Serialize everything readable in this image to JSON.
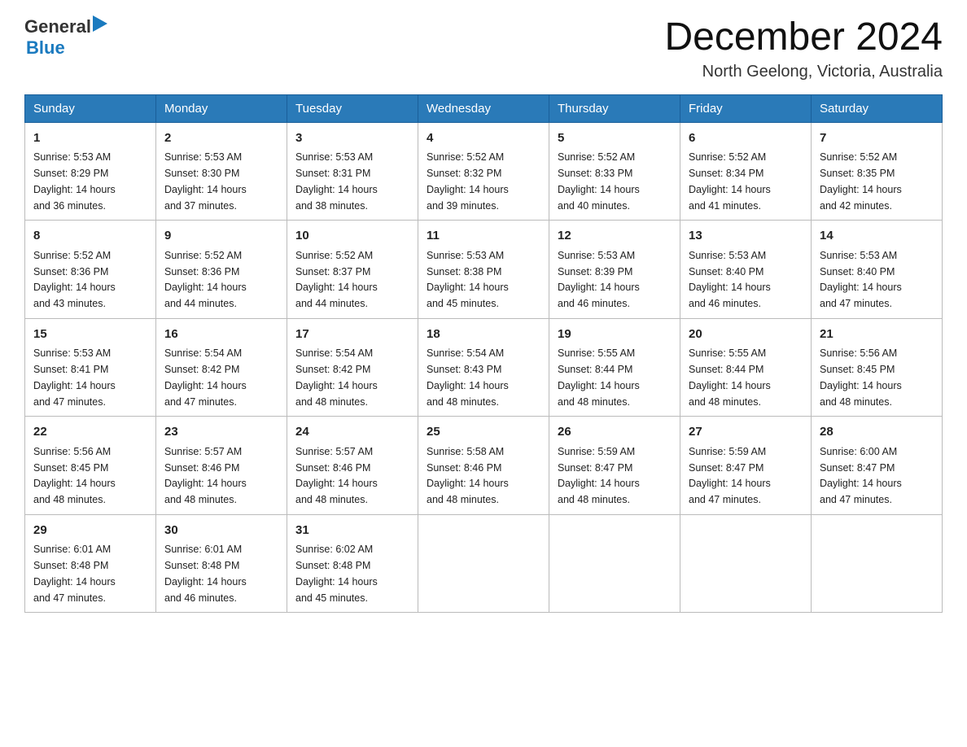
{
  "header": {
    "logo_general": "General",
    "logo_arrow": "▶",
    "logo_blue": "Blue",
    "month_title": "December 2024",
    "location": "North Geelong, Victoria, Australia"
  },
  "weekdays": [
    "Sunday",
    "Monday",
    "Tuesday",
    "Wednesday",
    "Thursday",
    "Friday",
    "Saturday"
  ],
  "weeks": [
    [
      {
        "day": "1",
        "sunrise": "5:53 AM",
        "sunset": "8:29 PM",
        "daylight": "14 hours and 36 minutes."
      },
      {
        "day": "2",
        "sunrise": "5:53 AM",
        "sunset": "8:30 PM",
        "daylight": "14 hours and 37 minutes."
      },
      {
        "day": "3",
        "sunrise": "5:53 AM",
        "sunset": "8:31 PM",
        "daylight": "14 hours and 38 minutes."
      },
      {
        "day": "4",
        "sunrise": "5:52 AM",
        "sunset": "8:32 PM",
        "daylight": "14 hours and 39 minutes."
      },
      {
        "day": "5",
        "sunrise": "5:52 AM",
        "sunset": "8:33 PM",
        "daylight": "14 hours and 40 minutes."
      },
      {
        "day": "6",
        "sunrise": "5:52 AM",
        "sunset": "8:34 PM",
        "daylight": "14 hours and 41 minutes."
      },
      {
        "day": "7",
        "sunrise": "5:52 AM",
        "sunset": "8:35 PM",
        "daylight": "14 hours and 42 minutes."
      }
    ],
    [
      {
        "day": "8",
        "sunrise": "5:52 AM",
        "sunset": "8:36 PM",
        "daylight": "14 hours and 43 minutes."
      },
      {
        "day": "9",
        "sunrise": "5:52 AM",
        "sunset": "8:36 PM",
        "daylight": "14 hours and 44 minutes."
      },
      {
        "day": "10",
        "sunrise": "5:52 AM",
        "sunset": "8:37 PM",
        "daylight": "14 hours and 44 minutes."
      },
      {
        "day": "11",
        "sunrise": "5:53 AM",
        "sunset": "8:38 PM",
        "daylight": "14 hours and 45 minutes."
      },
      {
        "day": "12",
        "sunrise": "5:53 AM",
        "sunset": "8:39 PM",
        "daylight": "14 hours and 46 minutes."
      },
      {
        "day": "13",
        "sunrise": "5:53 AM",
        "sunset": "8:40 PM",
        "daylight": "14 hours and 46 minutes."
      },
      {
        "day": "14",
        "sunrise": "5:53 AM",
        "sunset": "8:40 PM",
        "daylight": "14 hours and 47 minutes."
      }
    ],
    [
      {
        "day": "15",
        "sunrise": "5:53 AM",
        "sunset": "8:41 PM",
        "daylight": "14 hours and 47 minutes."
      },
      {
        "day": "16",
        "sunrise": "5:54 AM",
        "sunset": "8:42 PM",
        "daylight": "14 hours and 47 minutes."
      },
      {
        "day": "17",
        "sunrise": "5:54 AM",
        "sunset": "8:42 PM",
        "daylight": "14 hours and 48 minutes."
      },
      {
        "day": "18",
        "sunrise": "5:54 AM",
        "sunset": "8:43 PM",
        "daylight": "14 hours and 48 minutes."
      },
      {
        "day": "19",
        "sunrise": "5:55 AM",
        "sunset": "8:44 PM",
        "daylight": "14 hours and 48 minutes."
      },
      {
        "day": "20",
        "sunrise": "5:55 AM",
        "sunset": "8:44 PM",
        "daylight": "14 hours and 48 minutes."
      },
      {
        "day": "21",
        "sunrise": "5:56 AM",
        "sunset": "8:45 PM",
        "daylight": "14 hours and 48 minutes."
      }
    ],
    [
      {
        "day": "22",
        "sunrise": "5:56 AM",
        "sunset": "8:45 PM",
        "daylight": "14 hours and 48 minutes."
      },
      {
        "day": "23",
        "sunrise": "5:57 AM",
        "sunset": "8:46 PM",
        "daylight": "14 hours and 48 minutes."
      },
      {
        "day": "24",
        "sunrise": "5:57 AM",
        "sunset": "8:46 PM",
        "daylight": "14 hours and 48 minutes."
      },
      {
        "day": "25",
        "sunrise": "5:58 AM",
        "sunset": "8:46 PM",
        "daylight": "14 hours and 48 minutes."
      },
      {
        "day": "26",
        "sunrise": "5:59 AM",
        "sunset": "8:47 PM",
        "daylight": "14 hours and 48 minutes."
      },
      {
        "day": "27",
        "sunrise": "5:59 AM",
        "sunset": "8:47 PM",
        "daylight": "14 hours and 47 minutes."
      },
      {
        "day": "28",
        "sunrise": "6:00 AM",
        "sunset": "8:47 PM",
        "daylight": "14 hours and 47 minutes."
      }
    ],
    [
      {
        "day": "29",
        "sunrise": "6:01 AM",
        "sunset": "8:48 PM",
        "daylight": "14 hours and 47 minutes."
      },
      {
        "day": "30",
        "sunrise": "6:01 AM",
        "sunset": "8:48 PM",
        "daylight": "14 hours and 46 minutes."
      },
      {
        "day": "31",
        "sunrise": "6:02 AM",
        "sunset": "8:48 PM",
        "daylight": "14 hours and 45 minutes."
      },
      null,
      null,
      null,
      null
    ]
  ],
  "labels": {
    "sunrise": "Sunrise:",
    "sunset": "Sunset:",
    "daylight": "Daylight:"
  }
}
